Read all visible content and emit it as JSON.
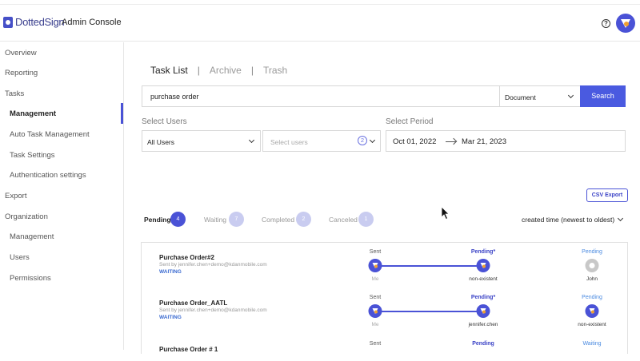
{
  "app": {
    "logo_text": "DottedSign",
    "title": "Admin Console"
  },
  "colors": {
    "accent": "#4a52d6",
    "search_button": "#4a5ae0",
    "waiting": "#3a6ad0"
  },
  "header": {
    "help_icon": "?"
  },
  "sidebar": {
    "items": [
      {
        "label": "Overview"
      },
      {
        "label": "Reporting"
      },
      {
        "label": "Tasks"
      },
      {
        "label": "Management"
      },
      {
        "label": "Auto Task Management"
      },
      {
        "label": "Task Settings"
      },
      {
        "label": "Authentication settings"
      },
      {
        "label": "Export"
      },
      {
        "label": "Organization"
      },
      {
        "label": "Management"
      },
      {
        "label": "Users"
      },
      {
        "label": "Permissions"
      }
    ]
  },
  "tabs": [
    {
      "label": "Task List"
    },
    {
      "label": "Archive"
    },
    {
      "label": "Trash"
    }
  ],
  "tab_separator": "|",
  "search": {
    "value": "purchase order",
    "scope": "Document",
    "button": "Search"
  },
  "filters": {
    "users_label": "Select Users",
    "users_value": "All Users",
    "select_users_placeholder": "Select users",
    "selected_count": "2",
    "period_label": "Select Period",
    "date_from": "Oct 01, 2022",
    "date_to": "Mar 21, 2023"
  },
  "csv_export": "CSV Export",
  "status_tabs": [
    {
      "label": "Pending",
      "count": "4"
    },
    {
      "label": "Waiting",
      "count": "7"
    },
    {
      "label": "Completed",
      "count": "2"
    },
    {
      "label": "Canceled",
      "count": "1"
    }
  ],
  "sort": "created time (newest to oldest)",
  "tasks": [
    {
      "title": "Purchase Order#2",
      "sender": "Sent by jennifer.chen+demo@kdanmobile.com",
      "status": "WAITING",
      "steps": [
        {
          "label": "Sent",
          "name": "Me"
        },
        {
          "label": "Pending*",
          "name": "non-existent"
        },
        {
          "label": "Pending",
          "name": "John"
        }
      ]
    },
    {
      "title": "Purchase Order_AATL",
      "sender": "Sent by jennifer.chen+demo@kdanmobile.com",
      "status": "WAITING",
      "steps": [
        {
          "label": "Sent",
          "name": "Me"
        },
        {
          "label": "Pending*",
          "name": "jennifer.chen"
        },
        {
          "label": "Pending",
          "name": "non-existent"
        }
      ]
    },
    {
      "title": "Purchase Order # 1",
      "steps": [
        {
          "label": "Sent"
        },
        {
          "label": "Pending"
        },
        {
          "label": "Waiting"
        }
      ]
    }
  ]
}
